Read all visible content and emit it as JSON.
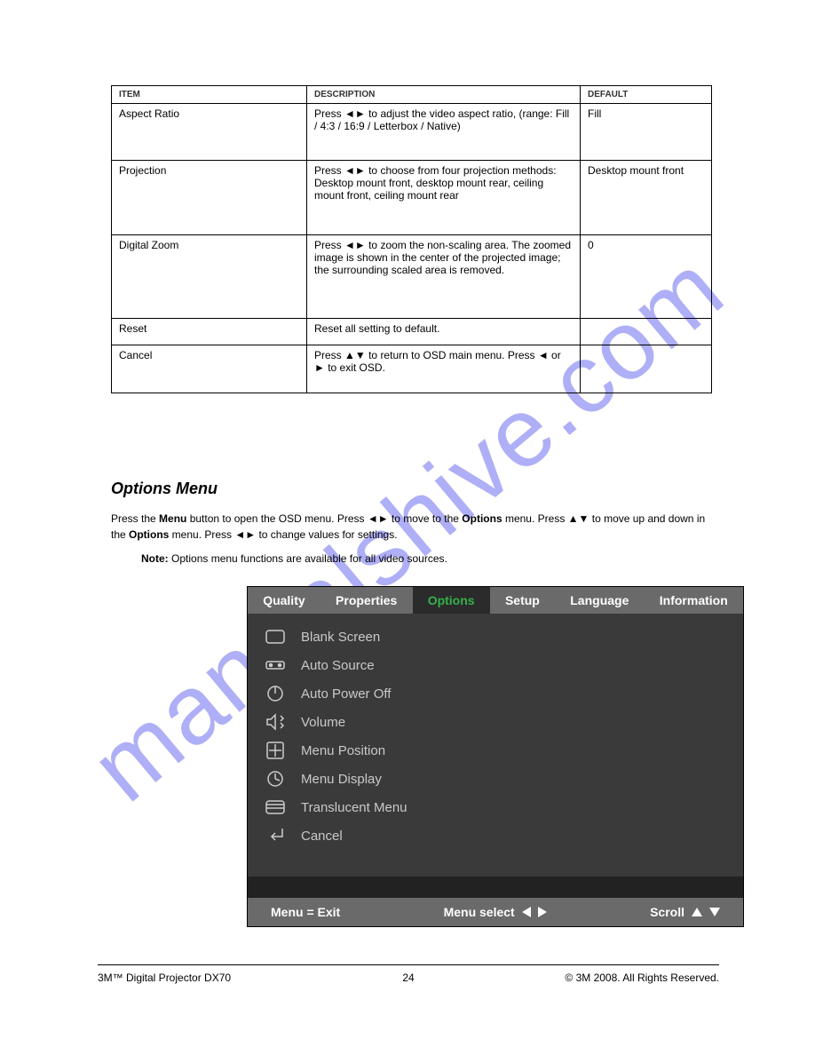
{
  "watermark": "manualshive.com",
  "table": {
    "headers": [
      "ITEM",
      "DESCRIPTION",
      "DEFAULT"
    ],
    "rows": [
      {
        "h": "h1",
        "item": "Aspect Ratio",
        "desc": "Press ◄► to adjust the video aspect ratio, (range: Fill / 4:3 / 16:9 / Letterbox / Native)",
        "def": "Fill"
      },
      {
        "h": "h2",
        "item": "Projection",
        "desc": "Press ◄► to choose from four projection methods:\nDesktop mount front, desktop mount rear, ceiling mount front, ceiling mount rear",
        "def": "Desktop mount front"
      },
      {
        "h": "h3",
        "item": "Digital Zoom",
        "desc": "Press ◄► to zoom the non-scaling area. The zoomed image is shown in the center of the projected image; the surrounding scaled area is removed.",
        "def": "0"
      },
      {
        "h": "h4",
        "item": "Reset",
        "desc": "Reset all setting to default.",
        "def": ""
      },
      {
        "h": "h5",
        "item": "Cancel",
        "desc": "Press ▲▼ to return to OSD main menu. Press ◄ or ► to exit OSD.",
        "def": ""
      }
    ]
  },
  "section": {
    "heading": "Options Menu",
    "intro_before_bold": "Press the ",
    "intro_bold": "Menu",
    "intro_after_bold": " button to open the OSD menu. Press ◄► to move to the ",
    "intro_bold2": "Options",
    "intro_after_bold2": " menu. Press ▲▼ to move up and down in the ",
    "intro_bold3": "Options",
    "intro_after_bold3": " menu. Press ◄► to change values for settings.",
    "note_label": "Note:",
    "note_text": "Options menu functions are available for all video sources."
  },
  "osd": {
    "tabs": [
      "Quality",
      "Properties",
      "Options",
      "Setup",
      "Language",
      "Information"
    ],
    "active_index": 2,
    "items": [
      {
        "icon": "blank-screen-icon",
        "label": "Blank Screen"
      },
      {
        "icon": "auto-source-icon",
        "label": "Auto Source"
      },
      {
        "icon": "auto-power-off-icon",
        "label": "Auto Power Off"
      },
      {
        "icon": "volume-icon",
        "label": "Volume"
      },
      {
        "icon": "menu-position-icon",
        "label": "Menu Position"
      },
      {
        "icon": "menu-display-icon",
        "label": "Menu Display"
      },
      {
        "icon": "translucent-menu-icon",
        "label": "Translucent Menu"
      },
      {
        "icon": "cancel-icon",
        "label": "Cancel"
      }
    ],
    "footer": {
      "left": "Menu = Exit",
      "center": "Menu select",
      "right": "Scroll"
    }
  },
  "footer": {
    "left": "3M™ Digital Projector DX70",
    "center": "24",
    "right": "© 3M 2008. All Rights Reserved."
  }
}
